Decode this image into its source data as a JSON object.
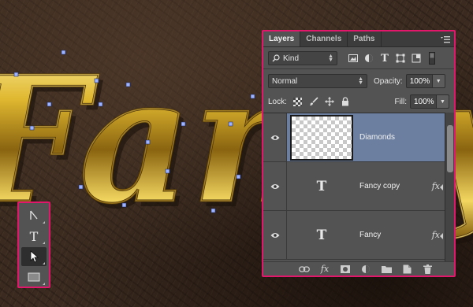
{
  "canvas": {
    "artwork_text": "Fancy",
    "accent_frame_color": "#e2176b"
  },
  "toolbox": {
    "tools": [
      {
        "icon": "path-selection-icon"
      },
      {
        "icon": "type-tool-icon",
        "glyph": "T"
      },
      {
        "icon": "direct-selection-icon",
        "active": true
      },
      {
        "icon": "rectangle-tool-icon"
      }
    ]
  },
  "layers_panel": {
    "tabs": [
      "Layers",
      "Channels",
      "Paths"
    ],
    "active_tab": "Layers",
    "filter": {
      "kind_label": "Kind",
      "icons": [
        "image-filter-icon",
        "adjustment-filter-icon",
        "type-filter-icon",
        "shape-filter-icon",
        "smart-object-filter-icon",
        "filter-toggle-icon"
      ],
      "type_glyph": "T"
    },
    "blend_mode": "Normal",
    "opacity_label": "Opacity:",
    "opacity_value": "100%",
    "lock_label": "Lock:",
    "fill_label": "Fill:",
    "fill_value": "100%",
    "layers": [
      {
        "name": "Diamonds",
        "kind": "raster",
        "selected": true,
        "visible": true
      },
      {
        "name": "Fancy copy",
        "kind": "type",
        "glyph": "T",
        "fx": "fx",
        "visible": true
      },
      {
        "name": "Fancy",
        "kind": "type",
        "glyph": "T",
        "fx": "fx",
        "visible": true
      }
    ],
    "bottom_icons": [
      "link-icon",
      "fx-icon",
      "mask-icon",
      "adjustment-icon",
      "folder-icon",
      "new-layer-icon",
      "trash-icon"
    ],
    "fx_glyph": "fx",
    "selected_color": "#6c7fa0"
  }
}
